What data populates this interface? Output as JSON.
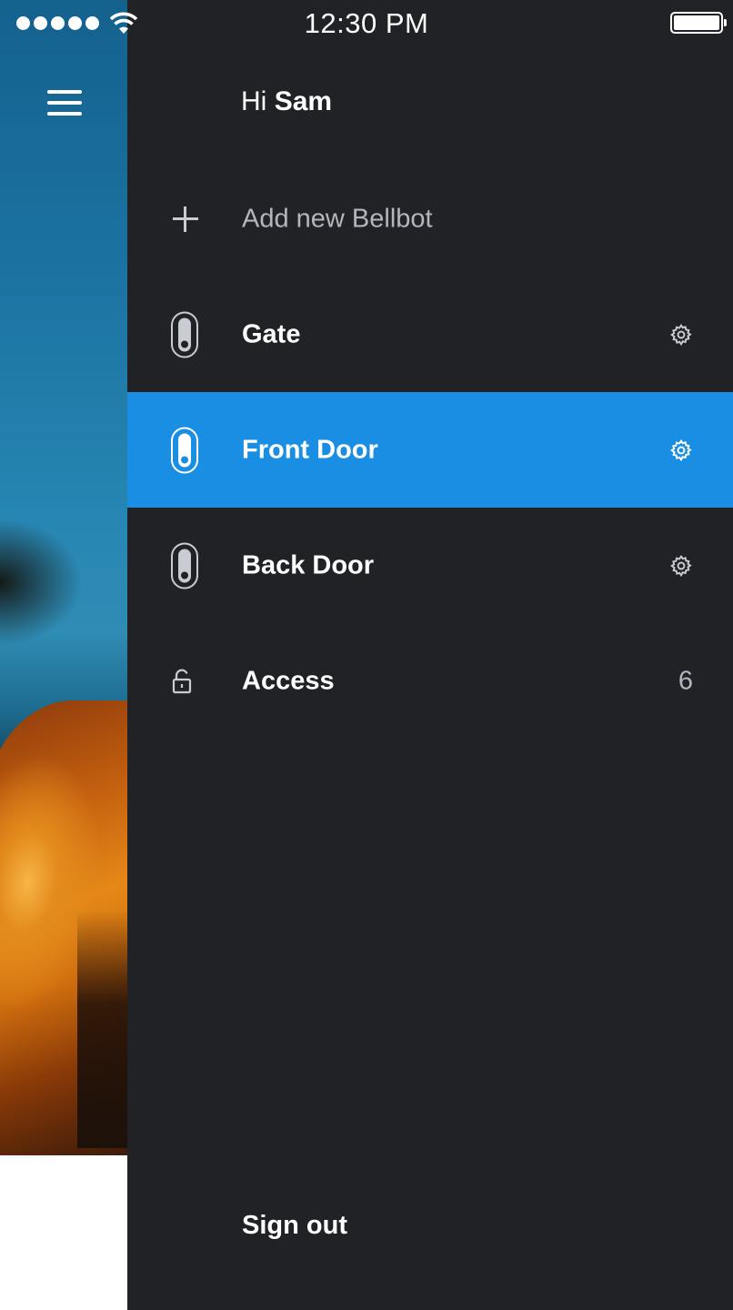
{
  "status_bar": {
    "time": "12:30 PM",
    "signal_icon": "signal-dots-icon",
    "wifi_icon": "wifi-icon",
    "battery_icon": "battery-full-icon"
  },
  "background": {
    "menu_icon": "hamburger-menu-icon"
  },
  "drawer": {
    "greeting_prefix": "Hi",
    "user_name": "Sam",
    "add_item": {
      "label": "Add new Bellbot",
      "icon": "plus-icon"
    },
    "devices": [
      {
        "label": "Gate",
        "icon": "bellbot-device-icon",
        "action_icon": "gear-icon",
        "active": false
      },
      {
        "label": "Front Door",
        "icon": "bellbot-device-icon",
        "action_icon": "gear-icon",
        "active": true
      },
      {
        "label": "Back Door",
        "icon": "bellbot-device-icon",
        "action_icon": "gear-icon",
        "active": false
      }
    ],
    "access": {
      "label": "Access",
      "count": "6",
      "icon": "unlock-icon"
    },
    "sign_out_label": "Sign out"
  },
  "colors": {
    "drawer_background": "#212226",
    "active_row": "#1a8ee3",
    "text_primary": "#ffffff",
    "text_secondary": "#b3b6bf"
  }
}
